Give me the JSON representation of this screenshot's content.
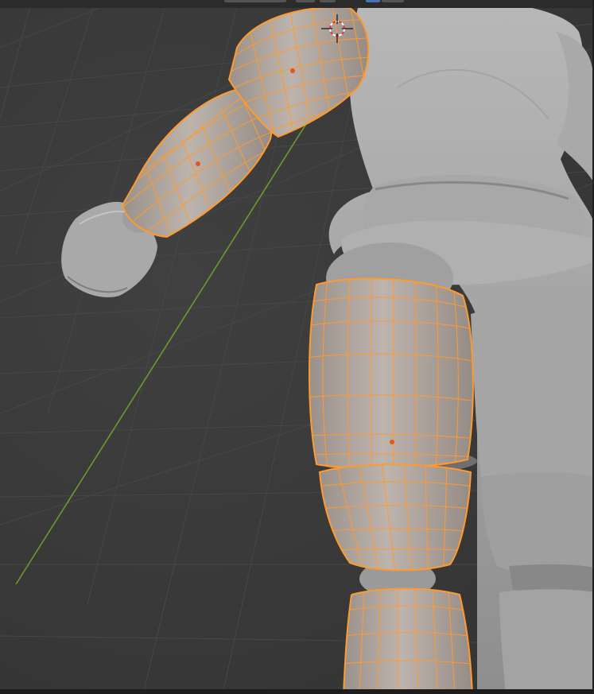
{
  "viewport": {
    "mode": "edit-mode-selection",
    "background": "#3a3a3a",
    "grid_color": "#4a4a4a",
    "axis_y_color": "#6b9a2c"
  },
  "colors": {
    "selection_wire": "#ff9a2e",
    "selection_tint": "#b2a9a3",
    "mesh_base": "#a4a4a4",
    "mesh_shadow": "#7c7c7c",
    "origin_dot": "#e0561d",
    "header_button_active": "#4772b3"
  },
  "icons": {
    "cursor": "3d-cursor-icon",
    "origin": "object-origin-icon"
  }
}
